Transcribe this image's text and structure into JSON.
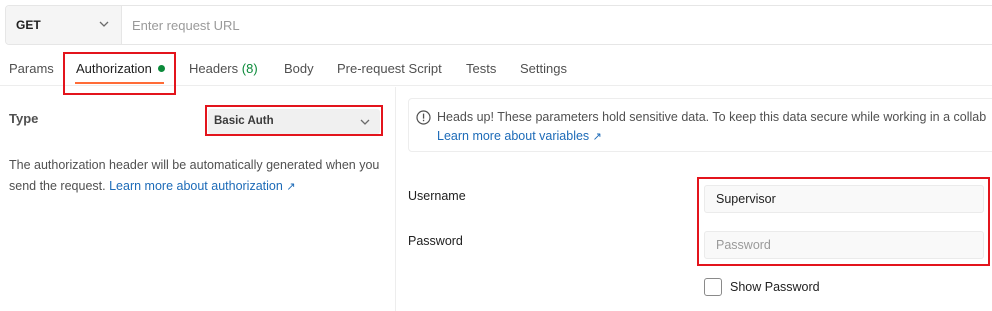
{
  "request": {
    "method": "GET",
    "url_placeholder": "Enter request URL",
    "url_value": ""
  },
  "tabs": [
    {
      "label": "Params"
    },
    {
      "label": "Authorization",
      "active": true,
      "status": "configured"
    },
    {
      "label": "Headers",
      "count": "(8)"
    },
    {
      "label": "Body"
    },
    {
      "label": "Pre-request Script"
    },
    {
      "label": "Tests"
    },
    {
      "label": "Settings"
    }
  ],
  "auth": {
    "type_label": "Type",
    "type_value": "Basic Auth",
    "description": "The authorization header will be automatically generated when you send the request.",
    "learn_more": "Learn more about authorization",
    "learn_more_arrow": "↗"
  },
  "notice": {
    "text": "Heads up! These parameters hold sensitive data. To keep this data secure while working in a collab",
    "link": "Learn more about variables",
    "link_arrow": "↗"
  },
  "fields": {
    "username_label": "Username",
    "username_value": "Supervisor",
    "password_label": "Password",
    "password_placeholder": "Password",
    "password_value": "",
    "show_password_label": "Show Password",
    "show_password_checked": false
  },
  "colors": {
    "accent": "#ff6c37",
    "link": "#1d6bb8",
    "status_green": "#0b8a3a",
    "highlight_red": "#e3141c"
  }
}
